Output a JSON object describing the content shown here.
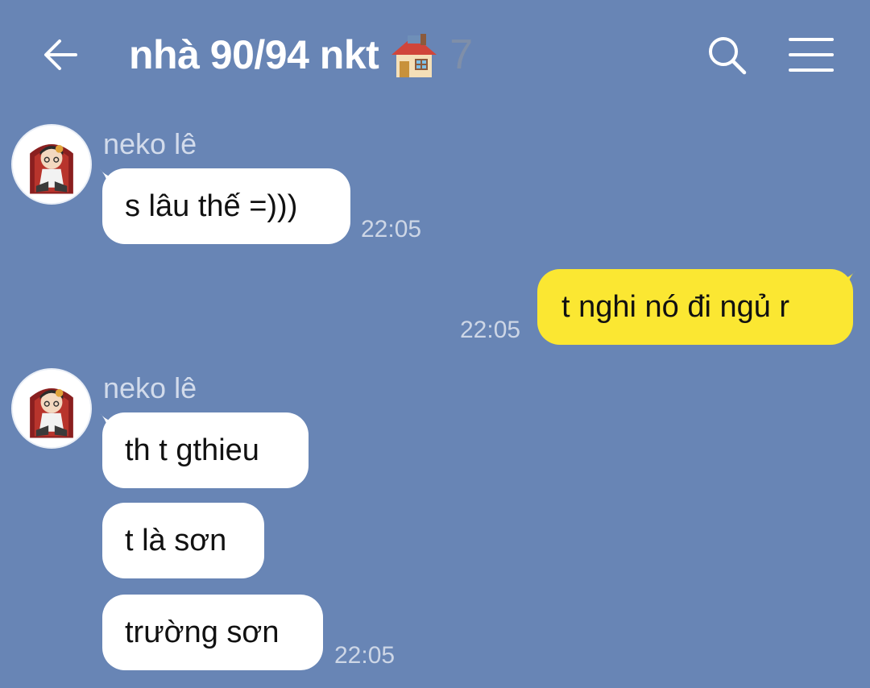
{
  "header": {
    "back_icon": "arrow-left-icon",
    "title": "nhà 90/94 nkt",
    "title_emoji": "house-with-garden-icon",
    "member_count": "7",
    "search_icon": "search-icon",
    "menu_icon": "hamburger-menu-icon"
  },
  "colors": {
    "background": "#6885b5",
    "incoming_bubble": "#ffffff",
    "outgoing_bubble": "#fbe732",
    "timestamp": "#cdd6e6",
    "sender_name": "#d2dbeb"
  },
  "messages": {
    "group1": {
      "sender": "neko lê",
      "items": [
        "s lâu thế =)))"
      ],
      "time": "22:05"
    },
    "outgoing1": {
      "text": "t nghi nó đi ngủ r",
      "time": "22:05"
    },
    "group2": {
      "sender": "neko lê",
      "items": [
        "th t gthieu",
        "t là sơn",
        "trường sơn"
      ],
      "time": "22:05"
    }
  }
}
